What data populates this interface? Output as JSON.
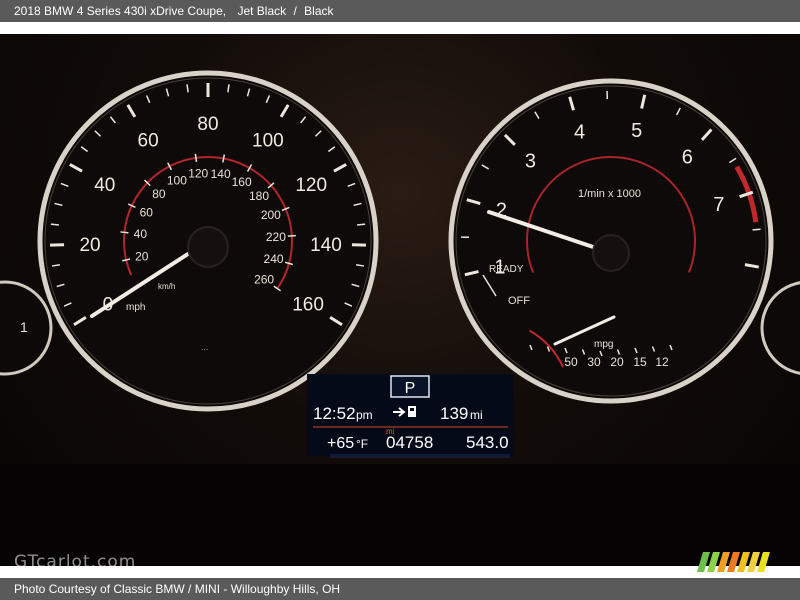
{
  "header": {
    "vehicle": "2018 BMW 4 Series 430i xDrive Coupe,",
    "color": "Jet Black",
    "interior": "Black"
  },
  "footer": {
    "credit": "Photo Courtesy of Classic BMW / MINI - Willoughby Hills, OH"
  },
  "watermark": "GTcarlot.com",
  "speedometer": {
    "mph_labels": [
      "0",
      "20",
      "40",
      "60",
      "80",
      "100",
      "120",
      "140",
      "160"
    ],
    "mph_unit": "mph",
    "kmh_labels": [
      "20",
      "40",
      "60",
      "80",
      "100",
      "120",
      "140",
      "160",
      "180",
      "200",
      "220",
      "240",
      "260"
    ],
    "kmh_unit": "km/h",
    "needle_value_mph": 0
  },
  "tachometer": {
    "labels": [
      "1",
      "2",
      "3",
      "4",
      "5",
      "6",
      "7"
    ],
    "unit": "1/min x 1000",
    "ready": "READY",
    "off": "OFF",
    "mpg_unit": "mpg",
    "mpg_labels": [
      "50",
      "30",
      "20",
      "15",
      "12"
    ]
  },
  "left_partial_gauge": {
    "label": "1"
  },
  "display": {
    "gear": "P",
    "time": "12:52",
    "time_suffix": "pm",
    "range_value": "139",
    "range_unit": "mi",
    "temp": "+65",
    "temp_unit": "°F",
    "odometer_unit": "mi",
    "odometer": "04758",
    "trip": "543.0"
  },
  "colors": {
    "ring": "#d8d2c8",
    "tick": "#ece6dc",
    "red_zone": "#c0282c",
    "lcd_bg": "#050a18",
    "lcd_accent": "#d04a2a",
    "bar": "#5a5a5a"
  }
}
